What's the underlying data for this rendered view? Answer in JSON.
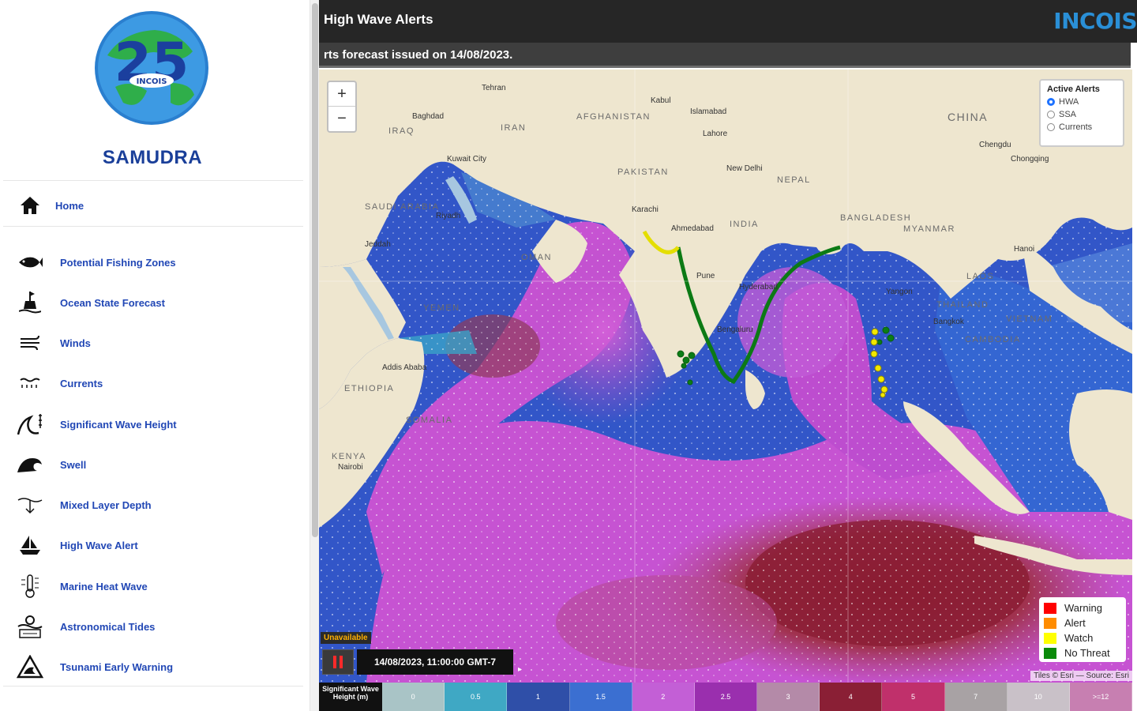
{
  "sidebar": {
    "app_name": "SAMUDRA",
    "logo_text": "INCOIS",
    "logo_number": "25",
    "home_label": "Home",
    "items": [
      {
        "label": "Potential Fishing Zones",
        "icon": "fish-icon"
      },
      {
        "label": "Ocean State Forecast",
        "icon": "buoy-icon"
      },
      {
        "label": "Winds",
        "icon": "wind-icon"
      },
      {
        "label": "Currents",
        "icon": "current-waves-icon"
      },
      {
        "label": "Significant Wave Height",
        "icon": "wave-height-icon"
      },
      {
        "label": "Swell",
        "icon": "swell-wave-icon"
      },
      {
        "label": "Mixed Layer Depth",
        "icon": "mixed-layer-icon"
      },
      {
        "label": "High Wave Alert",
        "icon": "ship-alert-icon"
      },
      {
        "label": "Marine Heat Wave",
        "icon": "thermometer-icon"
      },
      {
        "label": "Astronomical Tides",
        "icon": "tides-icon"
      },
      {
        "label": "Tsunami Early Warning",
        "icon": "tsunami-warning-icon"
      }
    ]
  },
  "header": {
    "title": "High Wave Alerts",
    "org_logo": "INCOIS",
    "ticker": "rts forecast issued on 14/08/2023."
  },
  "map": {
    "regions": [
      "CHINA",
      "IRAN",
      "IRAQ",
      "AFGHANISTAN",
      "PAKISTAN",
      "SAUDI ARABIA",
      "OMAN",
      "YEMEN",
      "ETHIOPIA",
      "SOMALIA",
      "KENYA",
      "INDIA",
      "NEPAL",
      "MYANMAR",
      "THAILAND",
      "LAOS",
      "CAMBODIA",
      "VIETNAM",
      "BANGLADESH"
    ],
    "cities": [
      "Tehran",
      "Kabul",
      "Islamabad",
      "Baghdad",
      "Kuwait City",
      "Riyadh",
      "Jeddah",
      "Karachi",
      "Ahmedabad",
      "New Delhi",
      "Lahore",
      "Pune",
      "Hyderabad",
      "Bengaluru",
      "Chengdu",
      "Chongqing",
      "Bangkok",
      "Yangon",
      "Addis Ababa",
      "Nairobi",
      "Hanoi"
    ],
    "zoom_in": "+",
    "zoom_out": "−",
    "active_alerts": {
      "title": "Active Alerts",
      "options": [
        {
          "label": "HWA",
          "checked": true
        },
        {
          "label": "SSA",
          "checked": false
        },
        {
          "label": "Currents",
          "checked": false
        }
      ]
    },
    "legend": [
      {
        "label": "Warning",
        "color": "#ff0000"
      },
      {
        "label": "Alert",
        "color": "#ff8c00"
      },
      {
        "label": "Watch",
        "color": "#ffff00"
      },
      {
        "label": "No Threat",
        "color": "#0a8a0a"
      }
    ],
    "unavailable": "Unavailable",
    "timestamp": "14/08/2023, 11:00:00 GMT-7",
    "attribution": "Tiles © Esri — Source: Esri"
  },
  "colorbar": {
    "label": "Significant Wave Height (m)",
    "segments": [
      {
        "value": "0",
        "color": "#a9c4c6"
      },
      {
        "value": "0.5",
        "color": "#3fa8c4"
      },
      {
        "value": "1",
        "color": "#2f4fa8"
      },
      {
        "value": "1.5",
        "color": "#3b6fd1"
      },
      {
        "value": "2",
        "color": "#c35fd6"
      },
      {
        "value": "2.5",
        "color": "#9a2fae"
      },
      {
        "value": "3",
        "color": "#b48aa8"
      },
      {
        "value": "4",
        "color": "#8a1f35"
      },
      {
        "value": "5",
        "color": "#c0306b"
      },
      {
        "value": "7",
        "color": "#a8a2a4"
      },
      {
        "value": "10",
        "color": "#c9c1c8"
      },
      {
        "value": ">=12",
        "color": "#c77fb1"
      }
    ]
  }
}
